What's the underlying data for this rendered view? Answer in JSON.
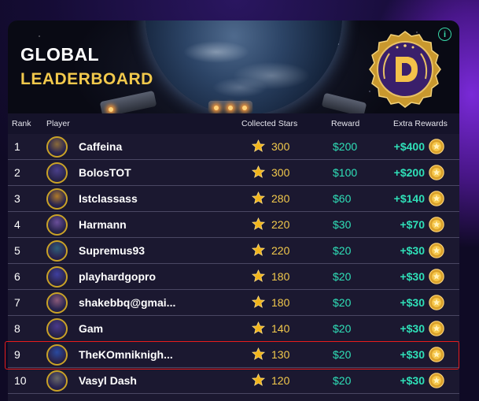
{
  "banner": {
    "title_line1": "GLOBAL",
    "title_line2": "LEADERBOARD",
    "info_icon": "i",
    "medal_letter": "D"
  },
  "table": {
    "headers": {
      "rank": "Rank",
      "player": "Player",
      "stars": "Collected Stars",
      "reward": "Reward",
      "extra": "Extra Rewards"
    },
    "rows": [
      {
        "rank": "1",
        "player": "Caffeina",
        "stars": "300",
        "reward": "$200",
        "extra": "+$400"
      },
      {
        "rank": "2",
        "player": "BolosTOT",
        "stars": "300",
        "reward": "$100",
        "extra": "+$200"
      },
      {
        "rank": "3",
        "player": "Istclassass",
        "stars": "280",
        "reward": "$60",
        "extra": "+$140"
      },
      {
        "rank": "4",
        "player": "Harmann",
        "stars": "220",
        "reward": "$30",
        "extra": "+$70"
      },
      {
        "rank": "5",
        "player": "Supremus93",
        "stars": "220",
        "reward": "$20",
        "extra": "+$30"
      },
      {
        "rank": "6",
        "player": "playhardgopro",
        "stars": "180",
        "reward": "$20",
        "extra": "+$30"
      },
      {
        "rank": "7",
        "player": "shakebbq@gmai...",
        "stars": "180",
        "reward": "$20",
        "extra": "+$30"
      },
      {
        "rank": "8",
        "player": "Gam",
        "stars": "140",
        "reward": "$20",
        "extra": "+$30"
      },
      {
        "rank": "9",
        "player": "TheKOmniknigh...",
        "stars": "130",
        "reward": "$20",
        "extra": "+$30"
      },
      {
        "rank": "10",
        "player": "Vasyl Dash",
        "stars": "120",
        "reward": "$20",
        "extra": "+$30"
      }
    ]
  },
  "colors": {
    "gold": "#f2c94c",
    "teal": "#2fe0b8",
    "highlight": "#e81c1c"
  }
}
